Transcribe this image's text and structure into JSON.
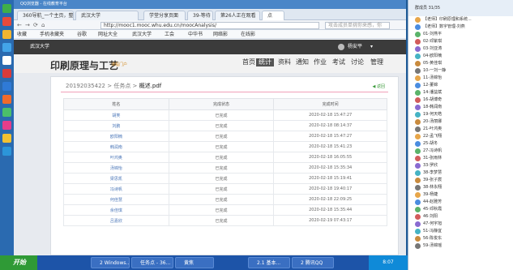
{
  "browser": {
    "title": "QQ浏览器 - 在线教育平台",
    "tabs": [
      "360导航_一个主页，整",
      "武汉大学",
      "学堂分享页面",
      "39-等待",
      "第26人正在观看",
      "点"
    ],
    "nav": {
      "back": "←",
      "forward": "→",
      "refresh": "⟳",
      "home": "⌂"
    },
    "address": "http://mooc1.mooc.whu.edu.cn/moocAnalysis/",
    "search_placeholder": "攻击成员单挑你来感，你",
    "favorites": [
      "收藏",
      "手机收藏夹",
      "谷歌",
      "网址大全",
      "武汉大学",
      "工会",
      "中华书",
      "网络影",
      "在线影"
    ]
  },
  "site": {
    "university": "武汉大学",
    "user": "杨安平",
    "course_title": "印刷原理与工艺",
    "course_sub": "课程门户",
    "nav": [
      "首页",
      "统计",
      "资料",
      "通知",
      "作业",
      "考试",
      "讨论",
      "管理"
    ],
    "active_nav": "统计"
  },
  "breadcrumb": {
    "id": "20192035422",
    "sep1": " > ",
    "level1": "任务点",
    "sep2": " > ",
    "current": "概述.pdf"
  },
  "back_label": "返回",
  "table": {
    "headers": [
      "姓名",
      "完成状态",
      "完成时间"
    ],
    "rows": [
      {
        "name": "胡笑",
        "status": "已完成",
        "time": "2020-02-18 15:47:27"
      },
      {
        "name": "刘鹏",
        "status": "已完成",
        "time": "2020-02-18 08:14:37"
      },
      {
        "name": "欧阳楠",
        "status": "已完成",
        "time": "2020-02-18 15:47:27"
      },
      {
        "name": "韩润南",
        "status": "已完成",
        "time": "2020-02-18 15:41:23"
      },
      {
        "name": "叶鸿奥",
        "status": "已完成",
        "time": "2020-02-18 16:05:55"
      },
      {
        "name": "汤锦怡",
        "status": "已完成",
        "time": "2020-02-18 15:35:34"
      },
      {
        "name": "梁思凯",
        "status": "已完成",
        "time": "2020-02-18 15:19:41"
      },
      {
        "name": "冯诗帆",
        "status": "已完成",
        "time": "2020-02-18 19:40:17"
      },
      {
        "name": "何佳慧",
        "status": "已完成",
        "time": "2020-02-18 22:09:25"
      },
      {
        "name": "余佳琪",
        "status": "已完成",
        "time": "2020-02-18 15:35:44"
      },
      {
        "name": "吕嘉欣",
        "status": "已完成",
        "time": "2020-02-19 07:43:17"
      }
    ]
  },
  "qq": {
    "header": "群成员 31/35",
    "members": [
      "【老师】印刷原理和系统...",
      "【老师】数字管理-刘燕",
      "01-刘燕平",
      "02-邓紫琪",
      "03-刘亚涛",
      "04-欧阳楠",
      "05-黄佳琪",
      "10-一刘一静",
      "11-汤锦怡",
      "12-董锦",
      "14-潘益斌",
      "16-胡博奇",
      "18-韩润南",
      "19-何天皓",
      "20-汤丽娜",
      "21-叶鸿奥",
      "22-孟飞翔",
      "25-胡冬",
      "27-冯诗帆",
      "31-张雨林",
      "33-罗欣",
      "38-李梦慧",
      "39-张子宸",
      "38-林永翔",
      "39-杨婕",
      "44-赵雅芳",
      "45-邓秋霞",
      "46-刘阳",
      "47-何宇旭",
      "51-冯静宜",
      "56-陈俊东",
      "59-汤锦瑶"
    ]
  },
  "taskbar": {
    "start": "开始",
    "tasks": [
      "2 Windows...",
      "任务点 - 36...",
      "黄焦",
      "2.1 基本...",
      "2 腾讯QQ"
    ],
    "clock": "8:07"
  },
  "zoom": "100%"
}
